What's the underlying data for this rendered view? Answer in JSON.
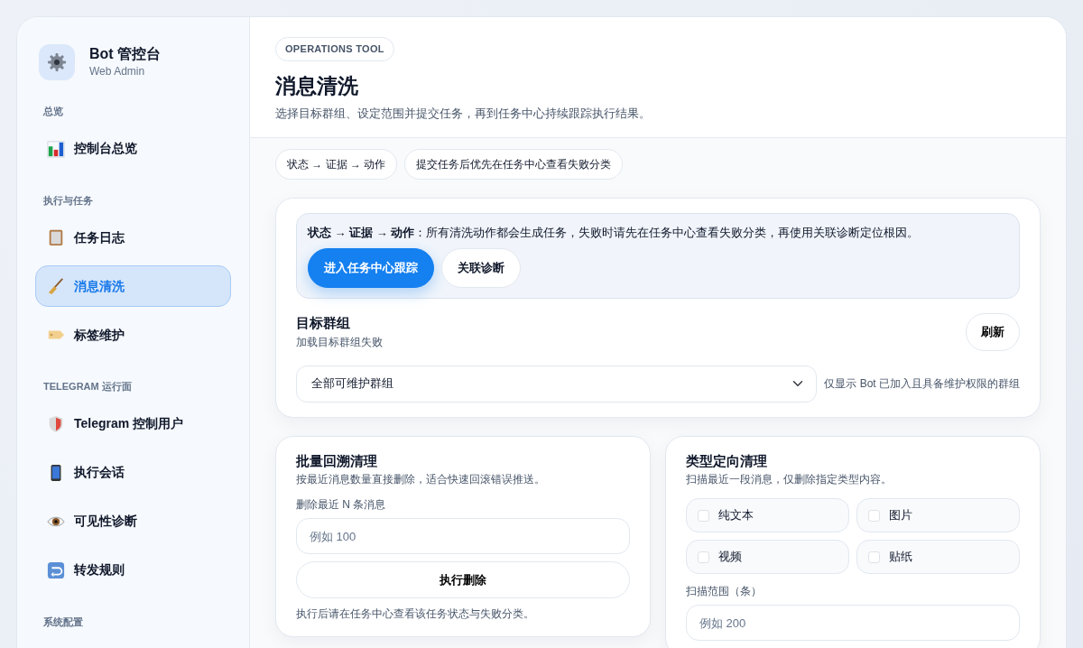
{
  "brand": {
    "title": "Bot 管控台",
    "subtitle": "Web Admin"
  },
  "sidebar": {
    "sections": [
      {
        "label": "总览",
        "items": [
          {
            "label": "控制台总览",
            "selected": false
          }
        ]
      },
      {
        "label": "执行与任务",
        "items": [
          {
            "label": "任务日志",
            "selected": false
          },
          {
            "label": "消息清洗",
            "selected": true
          },
          {
            "label": "标签维护",
            "selected": false
          }
        ]
      },
      {
        "label": "TELEGRAM 运行面",
        "items": [
          {
            "label": "Telegram 控制用户",
            "selected": false
          },
          {
            "label": "执行会话",
            "selected": false
          },
          {
            "label": "可见性诊断",
            "selected": false
          },
          {
            "label": "转发规则",
            "selected": false
          }
        ]
      },
      {
        "label": "系统配置"
      }
    ]
  },
  "header": {
    "eyebrow": "OPERATIONS TOOL",
    "title": "消息清洗",
    "subtitle": "选择目标群组、设定范围并提交任务，再到任务中心持续跟踪执行结果。"
  },
  "chips": [
    "状态 → 证据 → 动作",
    "提交任务后优先在任务中心查看失败分类"
  ],
  "callout": {
    "text": "**状态 → 证据 → 动作**：所有清洗动作都会生成任务，失败时请先在任务中心查看失败分类，再使用关联诊断定位根因。",
    "buttons": [
      {
        "label": "进入任务中心跟踪",
        "primary": true
      },
      {
        "label": "关联诊断",
        "primary": false
      }
    ]
  },
  "target_group": {
    "title": "目标群组",
    "status": "加载目标群组失败",
    "refresh": "刷新",
    "select_value": "全部可维护群组",
    "hint": "仅显示 Bot 已加入且具备维护权限的群组"
  },
  "batch": {
    "title": "批量回溯清理",
    "subtitle": "按最近消息数量直接删除，适合快速回滚错误推送。",
    "field_label": "删除最近 N 条消息",
    "placeholder": "例如 100",
    "button": "执行删除",
    "note": "执行后请在任务中心查看该任务状态与失败分类。"
  },
  "type_cleanup": {
    "title": "类型定向清理",
    "subtitle": "扫描最近一段消息，仅删除指定类型内容。",
    "options": [
      {
        "label": "纯文本",
        "checked": false
      },
      {
        "label": "图片",
        "checked": false
      },
      {
        "label": "视频",
        "checked": false
      },
      {
        "label": "贴纸",
        "checked": false
      }
    ],
    "field_label": "扫描范围（条）",
    "placeholder": "例如 200"
  }
}
